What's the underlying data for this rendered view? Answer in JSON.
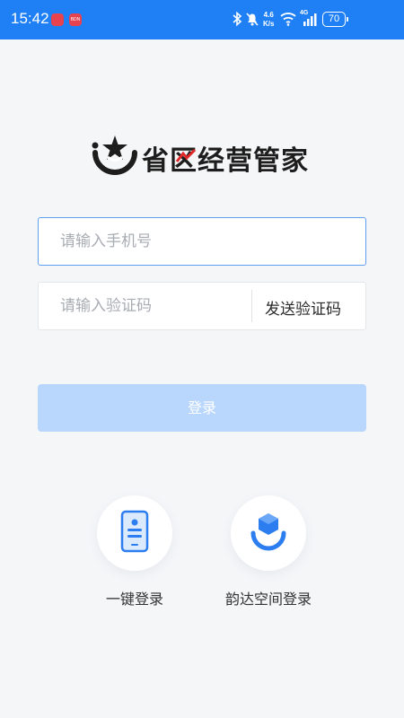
{
  "status_bar": {
    "time": "15:42",
    "notification_badge": "BDN",
    "speed_value": "4.6",
    "speed_unit": "K/s",
    "network": "4G",
    "battery": "70"
  },
  "logo": {
    "title": "省区经营管家"
  },
  "form": {
    "phone_placeholder": "请输入手机号",
    "code_placeholder": "请输入验证码",
    "send_code_label": "发送验证码",
    "login_label": "登录"
  },
  "alt_login": {
    "one_tap_label": "一键登录",
    "yunda_label": "韵达空间登录"
  },
  "colors": {
    "status_bar": "#1f80f5",
    "login_button_disabled": "#b9d6fd",
    "icon_blue": "#2c7ef0",
    "logo_red": "#e02a2a",
    "input_focus_border": "#5f9ff2"
  }
}
